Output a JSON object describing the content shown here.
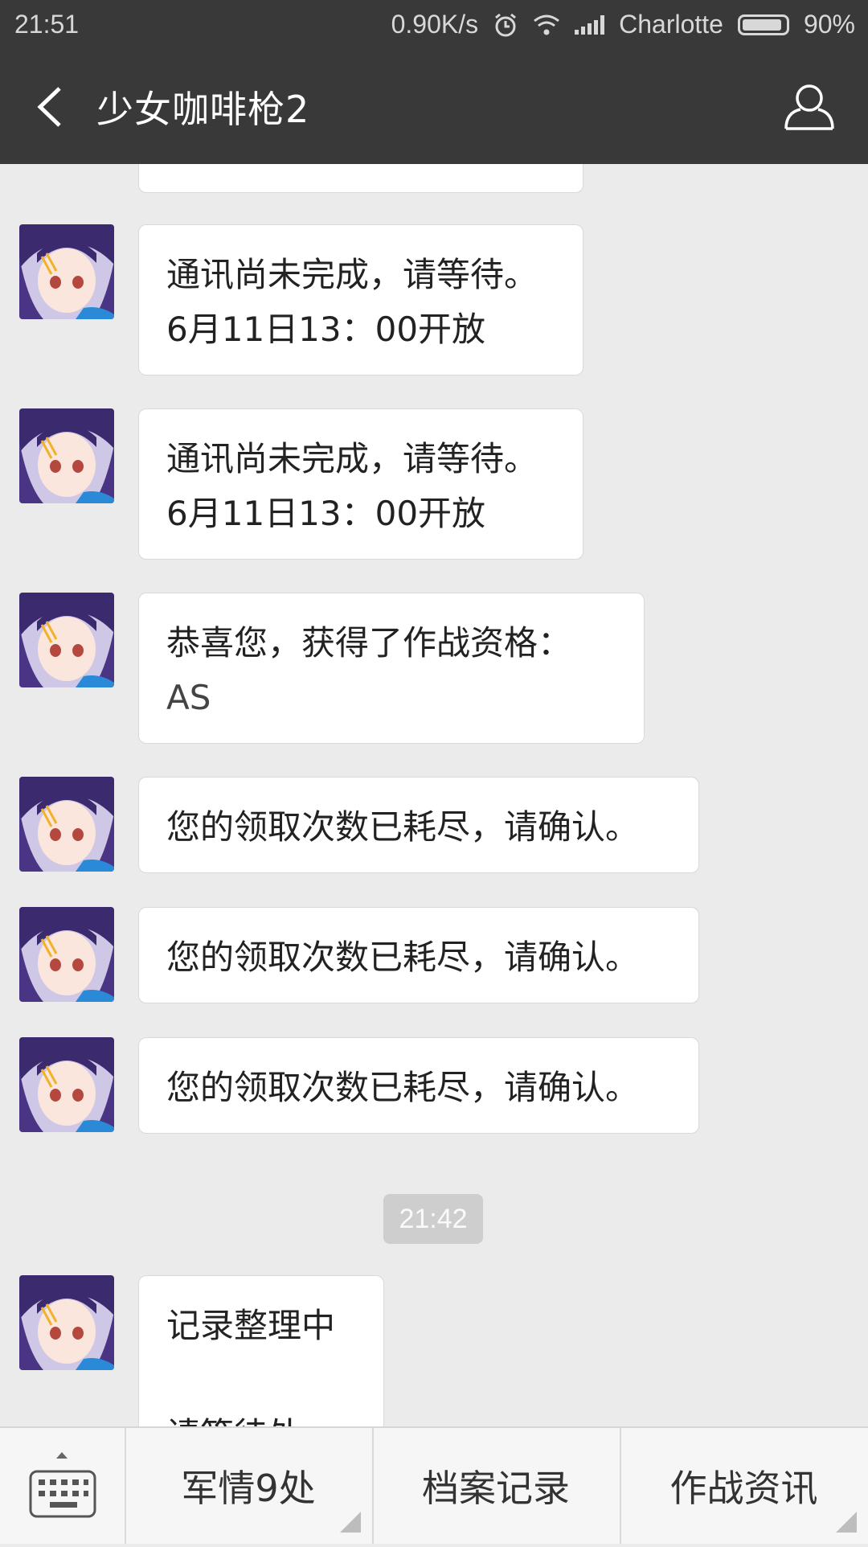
{
  "status_bar": {
    "time": "21:51",
    "speed": "0.90K/s",
    "carrier": "Charlotte",
    "battery": "90%"
  },
  "header": {
    "title": "少女咖啡枪2"
  },
  "messages": [
    {
      "lines": [
        "通讯尚未完成，请等待。",
        "6月11日13：00开放"
      ]
    },
    {
      "lines": [
        "通讯尚未完成，请等待。",
        "6月11日13：00开放"
      ]
    },
    {
      "lines": [
        "恭喜您，获得了作战资格：",
        "AS"
      ]
    },
    {
      "lines": [
        "您的领取次数已耗尽，请确认。"
      ]
    },
    {
      "lines": [
        "您的领取次数已耗尽，请确认。"
      ]
    },
    {
      "lines": [
        "您的领取次数已耗尽，请确认。"
      ]
    },
    {
      "lines": [
        "记录整理中",
        "",
        "请等待处"
      ]
    }
  ],
  "timestamp": "21:42",
  "menu": {
    "items": [
      "军情9处",
      "档案记录",
      "作战资讯"
    ]
  },
  "colors": {
    "bar": "#393939",
    "background": "#ebebeb",
    "bubble": "#ffffff"
  },
  "icons": [
    "back-arrow-icon",
    "profile-icon",
    "keyboard-icon",
    "alarm-icon",
    "wifi-icon",
    "signal-icon",
    "battery-icon"
  ]
}
